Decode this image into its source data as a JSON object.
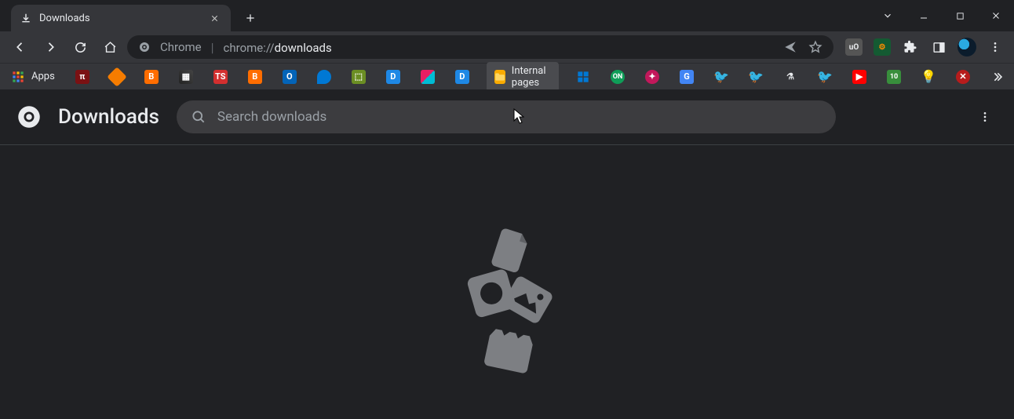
{
  "tab": {
    "title": "Downloads"
  },
  "omnibox": {
    "originLabel": "Chrome",
    "urlDim": "chrome://",
    "urlBright": "downloads"
  },
  "bookmarks": {
    "appsLabel": "Apps",
    "folderLabel": "Internal pages"
  },
  "downloadsPage": {
    "heading": "Downloads",
    "searchPlaceholder": "Search downloads"
  }
}
